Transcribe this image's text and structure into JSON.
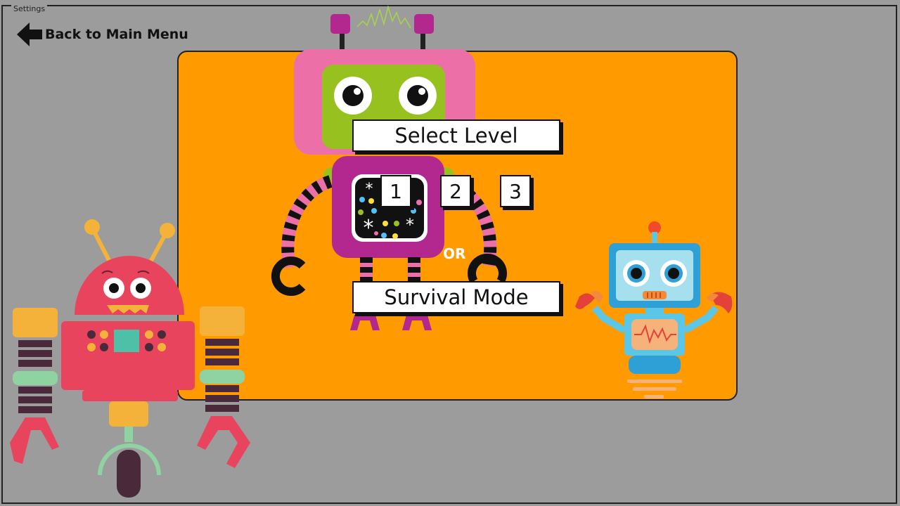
{
  "window": {
    "title": "Settings"
  },
  "nav": {
    "back_label": "Back to Main Menu",
    "back_icon": "arrow-left-icon"
  },
  "menu": {
    "select_level_label": "Select Level",
    "levels": [
      "1",
      "2",
      "3"
    ],
    "or_label": "OR",
    "survival_label": "Survival Mode"
  },
  "colors": {
    "background": "#9c9c9c",
    "panel": "#ff9b00",
    "pink_robot": "#ec6fa8",
    "green_face": "#97c11f",
    "purple_body": "#b2288f",
    "red_robot": "#e8445e",
    "blue_robot": "#5cc6e6"
  }
}
